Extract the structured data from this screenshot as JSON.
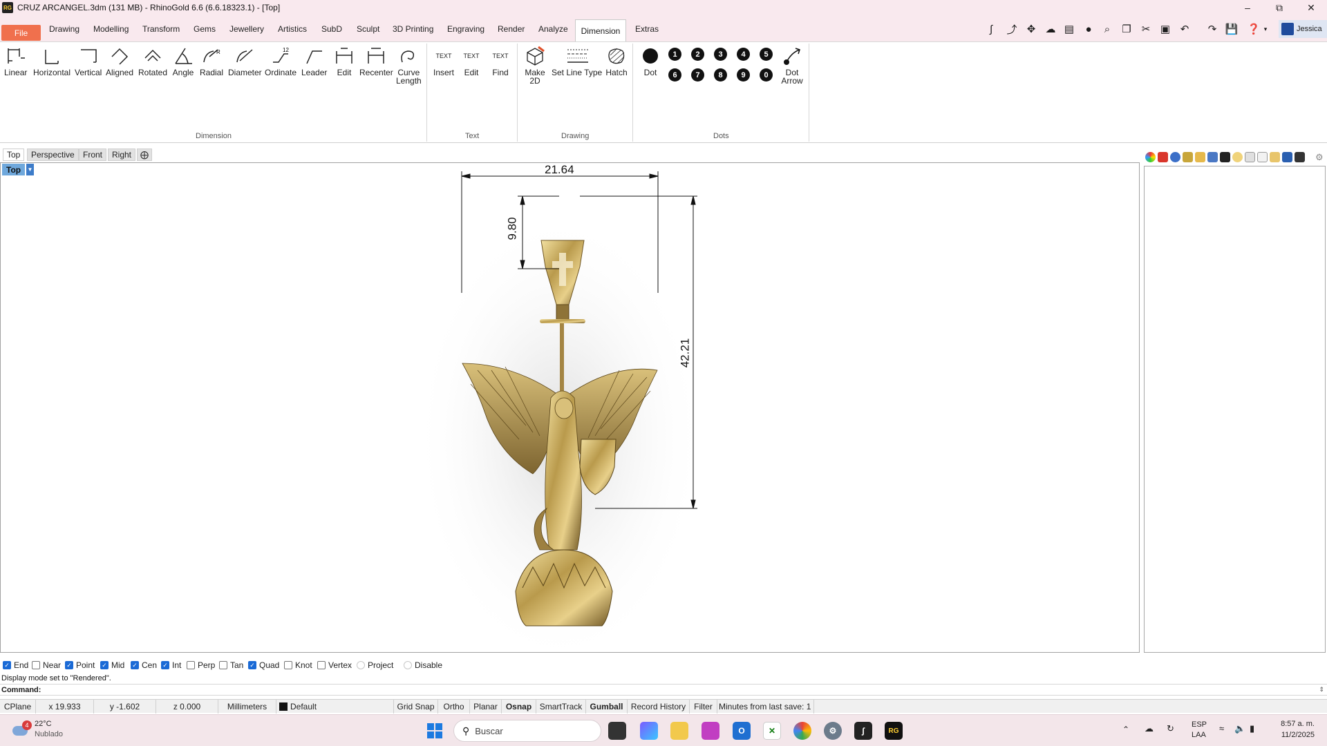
{
  "window": {
    "app_icon": "RG",
    "title": "CRUZ ARCANGEL.3dm (131 MB) - RhinoGold 6.6 (6.6.18323.1) - [Top]",
    "minimize_icon": "minimize-icon",
    "maximize_icon": "restore-icon",
    "close_icon": "close-icon"
  },
  "menu": {
    "file": "File",
    "tabs": [
      "Drawing",
      "Modelling",
      "Transform",
      "Gems",
      "Jewellery",
      "Artistics",
      "SubD",
      "Sculpt",
      "3D Printing",
      "Engraving",
      "Render",
      "Analyze",
      "Dimension",
      "Extras"
    ],
    "active": "Dimension",
    "user": "Jessica"
  },
  "ribbon": {
    "dimension_buttons": [
      {
        "label": "Linear",
        "icon": "linear-dimension-icon"
      },
      {
        "label": "Horizontal",
        "icon": "horizontal-dimension-icon"
      },
      {
        "label": "Vertical",
        "icon": "vertical-dimension-icon"
      },
      {
        "label": "Aligned",
        "icon": "aligned-dimension-icon"
      },
      {
        "label": "Rotated",
        "icon": "rotated-dimension-icon"
      },
      {
        "label": "Angle",
        "icon": "angle-dimension-icon"
      },
      {
        "label": "Radial",
        "icon": "radial-dimension-icon"
      },
      {
        "label": "Diameter",
        "icon": "diameter-dimension-icon"
      },
      {
        "label": "Ordinate",
        "icon": "ordinate-dimension-icon"
      },
      {
        "label": "Leader",
        "icon": "leader-icon"
      },
      {
        "label": "Edit",
        "icon": "edit-dimension-icon"
      },
      {
        "label": "Recenter",
        "icon": "recenter-icon"
      },
      {
        "label": "Curve\nLength",
        "icon": "curve-length-icon"
      }
    ],
    "text_buttons": [
      {
        "label": "Insert",
        "icon": "insert-text-icon",
        "glyph": "TEXT"
      },
      {
        "label": "Edit",
        "icon": "edit-text-icon",
        "glyph": "TEXT"
      },
      {
        "label": "Find",
        "icon": "find-text-icon",
        "glyph": "TEXT"
      }
    ],
    "drawing_buttons": [
      {
        "label": "Make\n2D",
        "icon": "make-2d-icon"
      },
      {
        "label": "Set Line Type",
        "icon": "set-line-type-icon"
      },
      {
        "label": "Hatch",
        "icon": "hatch-icon"
      }
    ],
    "dots_buttons": [
      {
        "label": "Dot",
        "icon": "dot-icon"
      },
      {
        "label": "Dot\nArrow",
        "icon": "dot-arrow-icon"
      }
    ],
    "dot_numbers_top": [
      "1",
      "2",
      "3",
      "4",
      "5"
    ],
    "dot_numbers_bottom": [
      "6",
      "7",
      "8",
      "9",
      "0"
    ],
    "groups": {
      "dimension": "Dimension",
      "text": "Text",
      "drawing": "Drawing",
      "dots": "Dots"
    }
  },
  "viewport": {
    "tabs": [
      "Top",
      "Perspective",
      "Front",
      "Right"
    ],
    "add_tab_icon": "add-viewport-icon",
    "label": "Top",
    "dimensions": {
      "width": "21.64",
      "bail_height": "9.80",
      "total_height": "42.21"
    }
  },
  "osnaps": [
    {
      "label": "End",
      "checked": true
    },
    {
      "label": "Near",
      "checked": false
    },
    {
      "label": "Point",
      "checked": true
    },
    {
      "label": "Mid",
      "checked": true
    },
    {
      "label": "Cen",
      "checked": true
    },
    {
      "label": "Int",
      "checked": true
    },
    {
      "label": "Perp",
      "checked": false
    },
    {
      "label": "Tan",
      "checked": false
    },
    {
      "label": "Quad",
      "checked": true
    },
    {
      "label": "Knot",
      "checked": false
    },
    {
      "label": "Vertex",
      "checked": false
    },
    {
      "label": "Project",
      "checked": false
    },
    {
      "label": "Disable",
      "checked": false
    }
  ],
  "command": {
    "history": "Display mode set to \"Rendered\".",
    "label": "Command:",
    "value": ""
  },
  "status": {
    "cplane": "CPlane",
    "x": "x 19.933",
    "y": "y -1.602",
    "z": "z 0.000",
    "units": "Millimeters",
    "layer": "Default",
    "grid_snap": "Grid Snap",
    "ortho": "Ortho",
    "planar": "Planar",
    "osnap": "Osnap",
    "smarttrack": "SmartTrack",
    "gumball": "Gumball",
    "record_history": "Record History",
    "filter": "Filter",
    "last_save": "Minutes from last save: 1"
  },
  "taskbar": {
    "weather_temp": "22°C",
    "weather_desc": "Nublado",
    "weather_badge": "4",
    "search_placeholder": "Buscar",
    "lang": "ESP",
    "lang_sub": "LAA",
    "time": "8:57 a. m.",
    "date": "11/2/2025"
  },
  "colors": {
    "title_bg": "#f9e9ee",
    "file_tab": "#f0704d",
    "viewport_label": "#6fa8dc",
    "checkbox_on": "#1a6ad6"
  }
}
